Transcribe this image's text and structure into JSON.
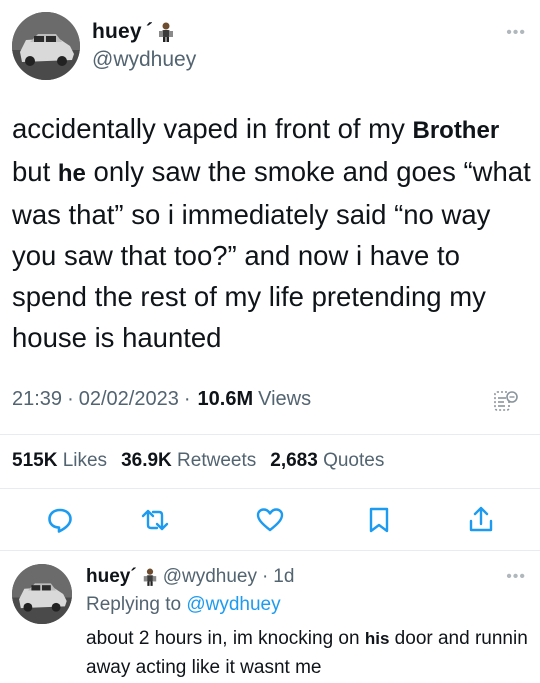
{
  "tweet": {
    "display_name": "huey",
    "name_mark": "´",
    "handle": "@wydhuey",
    "text_parts": [
      "accidentally vaped in front of my ",
      "Brother",
      " but ",
      "he",
      " only saw the smoke and goes “what was that” so i immediately said “no way you saw that too?” and now i have to spend the rest of my life pretending my house is haunted"
    ],
    "time": "21:39",
    "separator": "·",
    "date": "02/02/2023",
    "views_count": "10.6M",
    "views_label": "Views"
  },
  "stats": {
    "likes_count": "515K",
    "likes_label": "Likes",
    "retweets_count": "36.9K",
    "retweets_label": "Retweets",
    "quotes_count": "2,683",
    "quotes_label": "Quotes"
  },
  "actions": {
    "icons": [
      "reply-icon",
      "retweet-icon",
      "like-icon",
      "bookmark-icon",
      "share-icon"
    ],
    "color": "#1d9bf0"
  },
  "reply": {
    "display_name": "huey",
    "name_mark": "´",
    "handle": "@wydhuey",
    "age": "1d",
    "replying_label": "Replying to",
    "replying_handle": "@wydhuey",
    "text_parts": [
      "about 2 hours in, im knocking on ",
      "his",
      " door and runnin away acting like it wasnt me"
    ]
  },
  "colors": {
    "text": "#0f1419",
    "muted": "#536471",
    "accent": "#1d9bf0",
    "divider": "#e6ecf0"
  }
}
